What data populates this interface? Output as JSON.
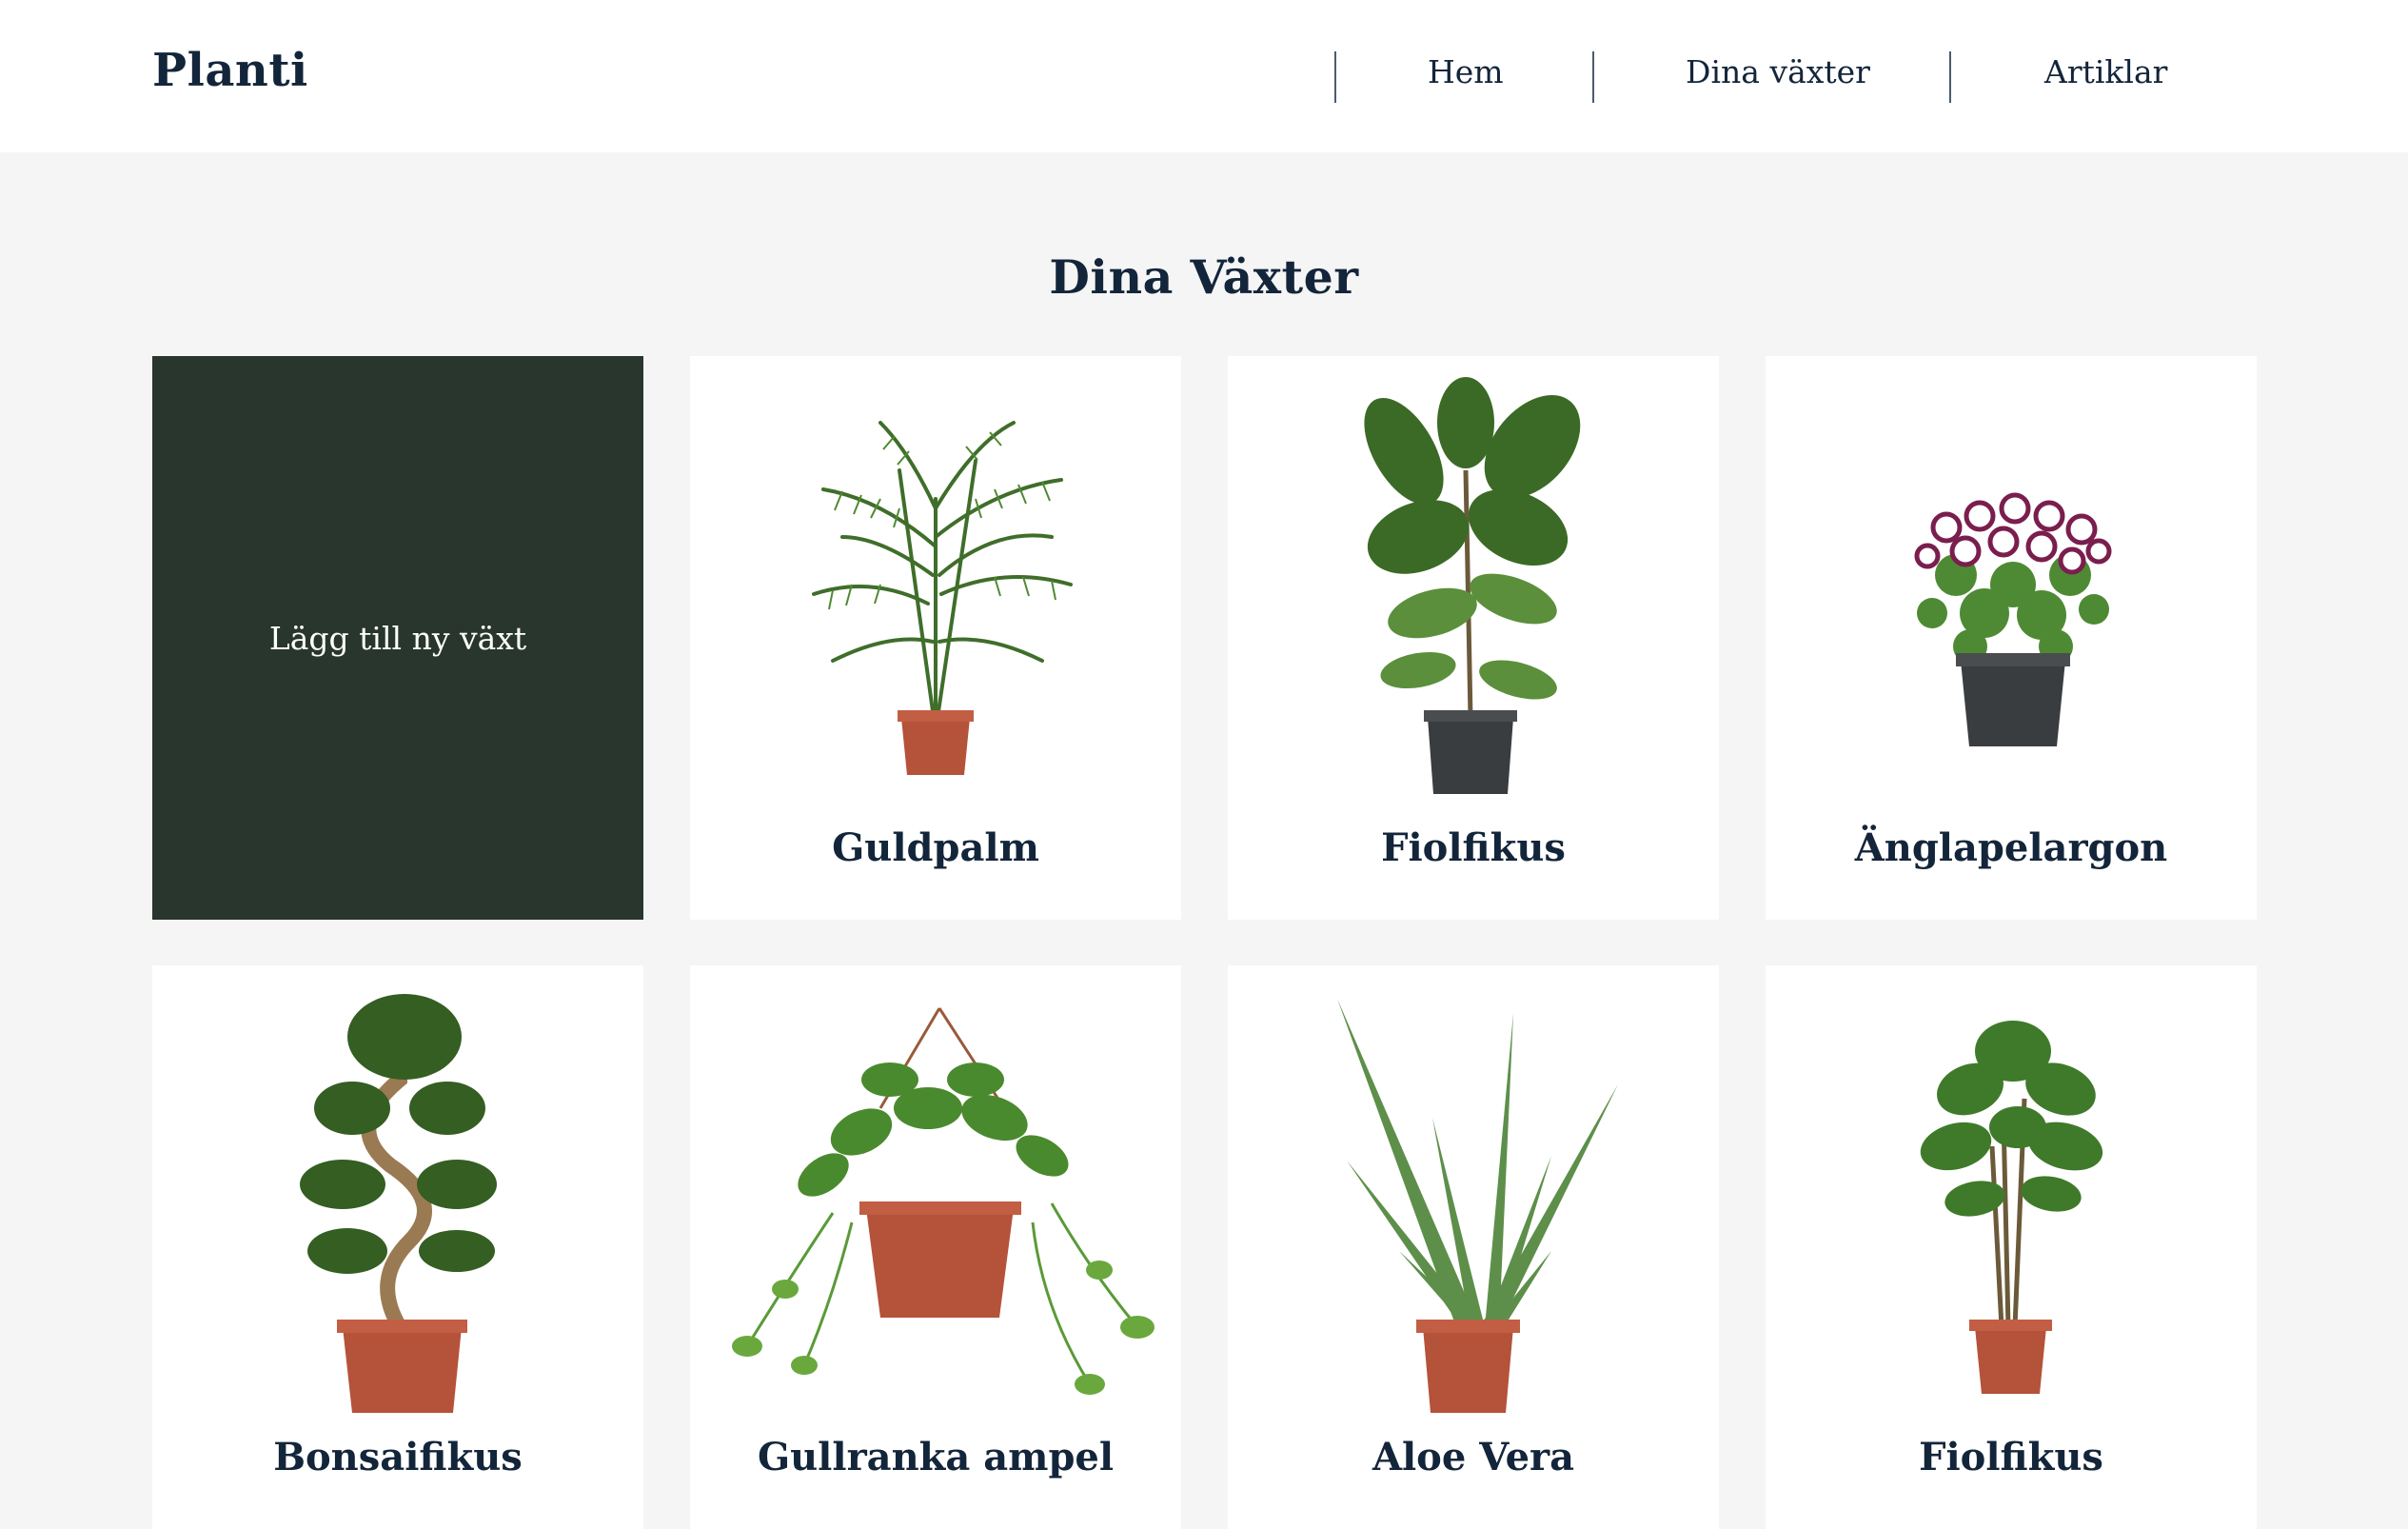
{
  "app": {
    "logo": "Planti"
  },
  "nav": {
    "home": "Hem",
    "my_plants": "Dina växter",
    "articles": "Artiklar"
  },
  "page": {
    "title": "Dina Växter"
  },
  "add_card": {
    "label": "Lägg till ny växt"
  },
  "plants": [
    {
      "name": "Guldpalm"
    },
    {
      "name": "Fiolfikus"
    },
    {
      "name": "Änglapelargon"
    },
    {
      "name": "Bonsaifikus"
    },
    {
      "name": "Gullranka ampel"
    },
    {
      "name": "Aloe Vera"
    },
    {
      "name": "Fiolfikus"
    }
  ],
  "colors": {
    "header_bg": "#ffffff",
    "page_bg": "#f5f5f5",
    "add_card_bg": "#28362d",
    "text": "#13253a",
    "terracotta_pot": "#b5523a",
    "black_pot": "#3a3d40",
    "leaf": "#3e6b2a"
  }
}
